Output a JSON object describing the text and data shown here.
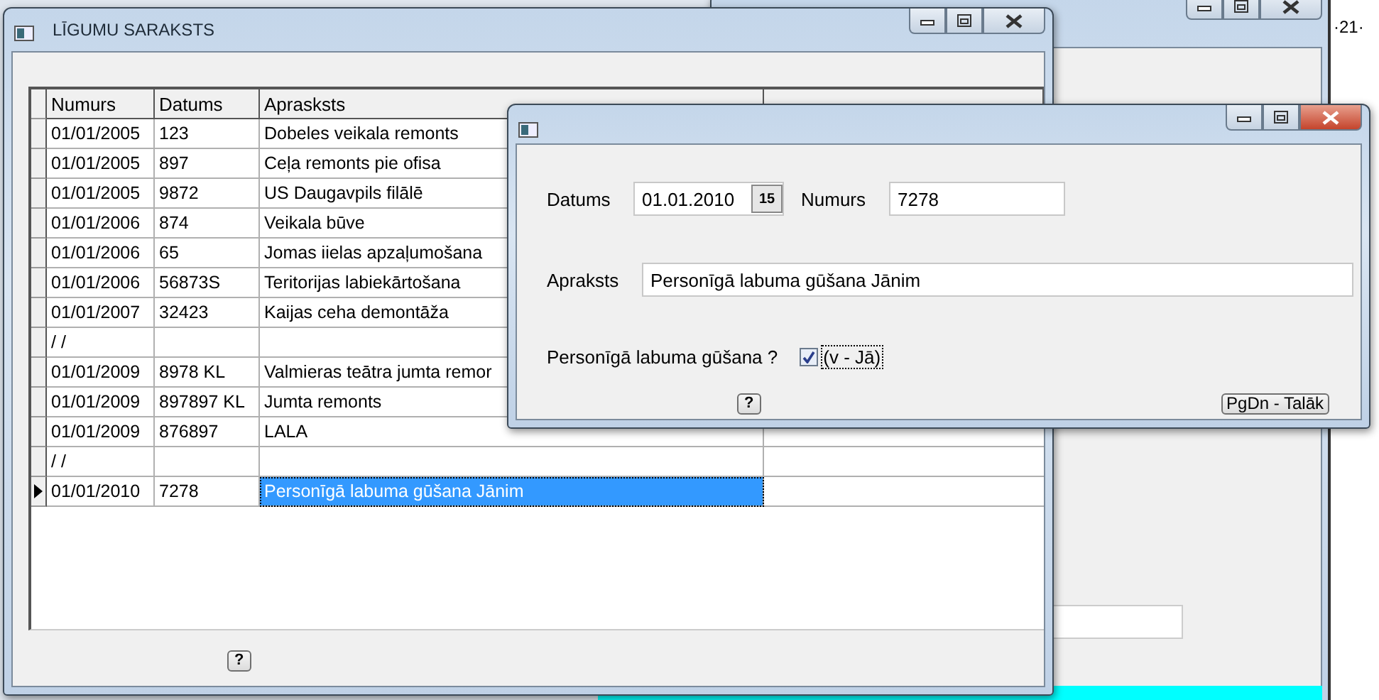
{
  "background_window": {
    "corner_text": "·21·"
  },
  "main_window": {
    "title": "LĪGUMU SARAKSTS",
    "table": {
      "columns": [
        "Numurs",
        "Datums",
        "Aprasksts"
      ],
      "rows": [
        {
          "cells": [
            "01/01/2005",
            "123",
            "Dobeles veikala remonts"
          ],
          "selected": false
        },
        {
          "cells": [
            "01/01/2005",
            "897",
            "Ceļa remonts pie ofisa"
          ],
          "selected": false
        },
        {
          "cells": [
            "01/01/2005",
            "9872",
            "US Daugavpils filālē"
          ],
          "selected": false
        },
        {
          "cells": [
            "01/01/2006",
            "874",
            "Veikala būve"
          ],
          "selected": false
        },
        {
          "cells": [
            "01/01/2006",
            "65",
            "Jomas iielas apzaļumošana"
          ],
          "selected": false
        },
        {
          "cells": [
            "01/01/2006",
            "56873S",
            "Teritorijas labiekārtošana"
          ],
          "selected": false
        },
        {
          "cells": [
            "01/01/2007",
            "32423",
            "Kaijas ceha demontāža"
          ],
          "selected": false
        },
        {
          "cells": [
            "/ /"
          ],
          "selected": false
        },
        {
          "cells": [
            "01/01/2009",
            "8978 KL",
            "Valmieras teātra jumta remor"
          ],
          "selected": false
        },
        {
          "cells": [
            "01/01/2009",
            "897897 KL",
            "Jumta remonts"
          ],
          "selected": false
        },
        {
          "cells": [
            "01/01/2009",
            "876897",
            "LALA"
          ],
          "selected": false
        },
        {
          "cells": [
            "/ /"
          ],
          "selected": false
        },
        {
          "cells": [
            "01/01/2010",
            "7278",
            "Personīgā labuma gūšana Jānim"
          ],
          "selected": true
        }
      ]
    },
    "help_button": "?"
  },
  "dialog": {
    "date": {
      "label": "Datums",
      "value": "01.01.2010",
      "calendar_button": "15"
    },
    "number": {
      "label": "Numurs",
      "value": "7278"
    },
    "description": {
      "label": "Apraksts",
      "value": "Personīgā labuma gūšana Jānim"
    },
    "personal_gain": {
      "label": "Personīgā labuma gūšana ?",
      "checked": true,
      "option_label": "(v - Jā)"
    },
    "help_button": "?",
    "next_button": "PgDn - Talāk"
  }
}
